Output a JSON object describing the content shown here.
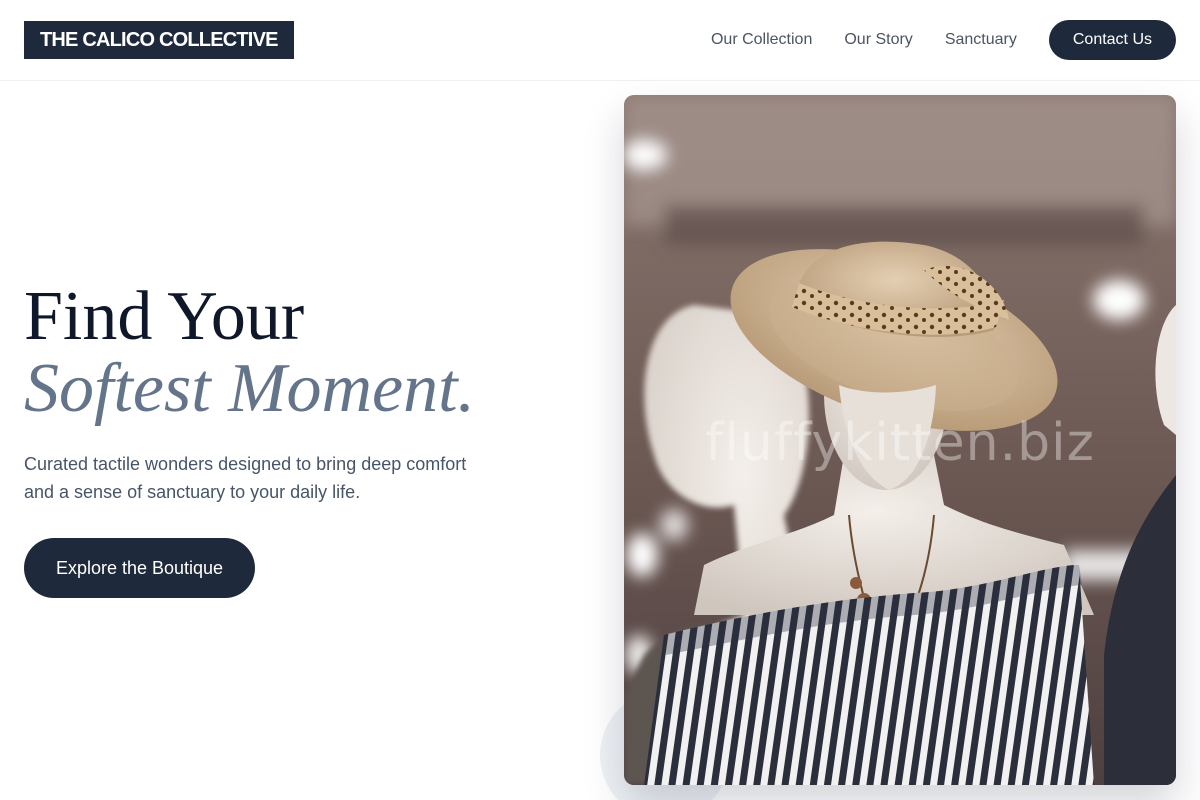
{
  "brand": {
    "name": "THE CALICO COLLECTIVE"
  },
  "nav": {
    "links": [
      "Our Collection",
      "Our Story",
      "Sanctuary"
    ],
    "contact_label": "Contact Us"
  },
  "hero": {
    "title_line1": "Find Your",
    "title_line2": "Softest Moment.",
    "description": "Curated tactile wonders designed to bring deep comfort and a sense of sanctuary to your daily life.",
    "cta_label": "Explore the Boutique",
    "image": {
      "subject": "mannequins-in-hat-and-striped-top",
      "watermark": "fluffykitten.biz"
    }
  },
  "colors": {
    "primary": "#1e293b",
    "accent_text": "#64748b",
    "body_text": "#475569",
    "nav_text": "#4b5563"
  }
}
